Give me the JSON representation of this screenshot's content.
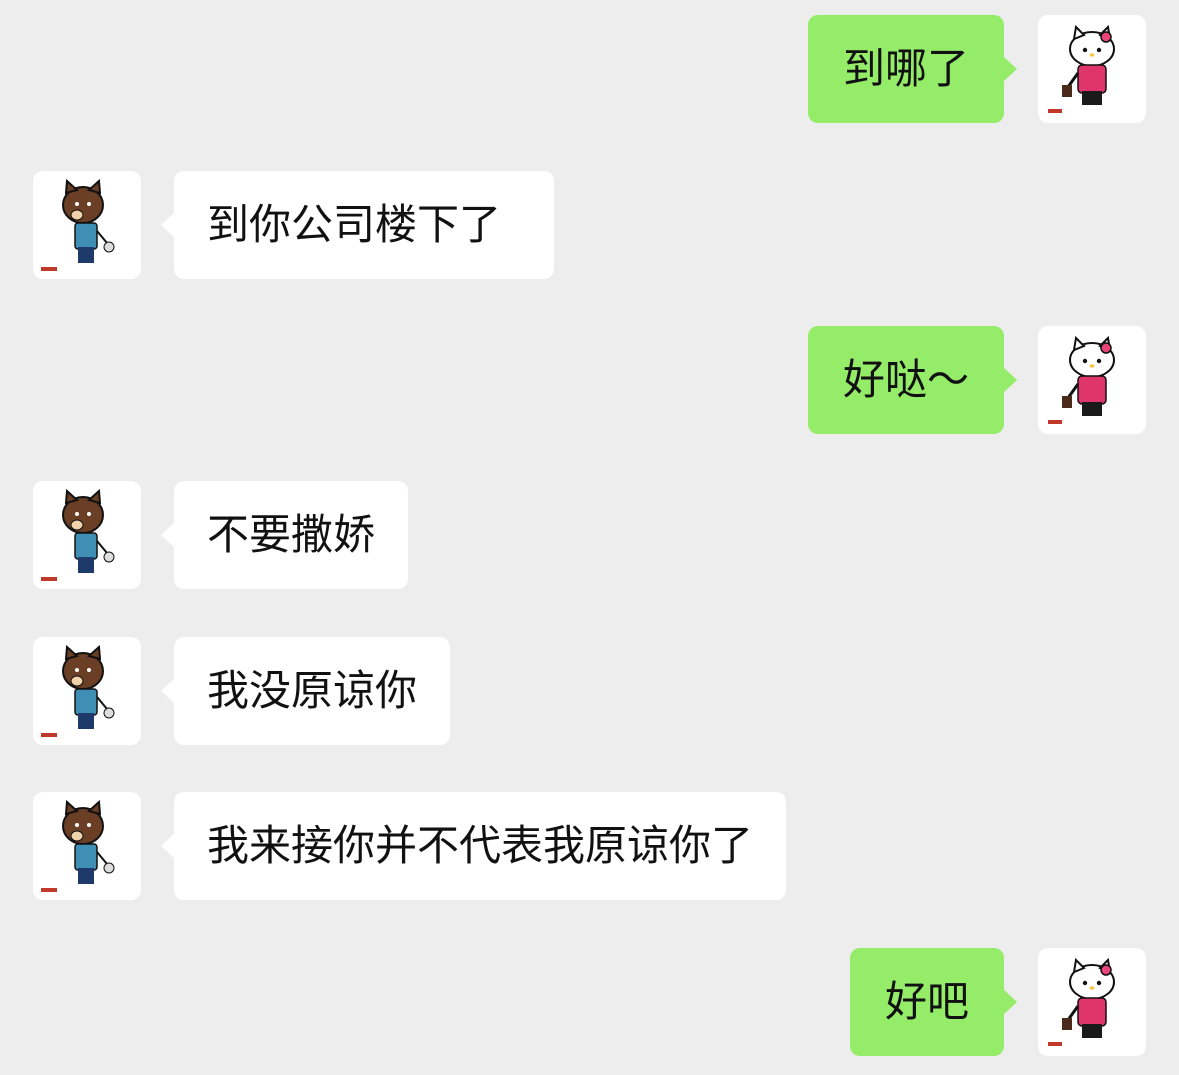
{
  "chat": {
    "messages": [
      {
        "sender": "me",
        "text": "到哪了"
      },
      {
        "sender": "other",
        "text": "到你公司楼下了"
      },
      {
        "sender": "me",
        "text": "好哒～"
      },
      {
        "sender": "other",
        "text": "不要撒娇"
      },
      {
        "sender": "other",
        "text": "我没原谅你"
      },
      {
        "sender": "other",
        "text": "我来接你并不代表我原谅你了"
      },
      {
        "sender": "me",
        "text": "好吧"
      }
    ]
  },
  "colors": {
    "background": "#ededed",
    "outgoing_bubble": "#95ec69",
    "incoming_bubble": "#ffffff",
    "text": "#111111"
  },
  "icons": {
    "me_avatar": "hello-kitty-avatar-icon",
    "other_avatar": "brown-cat-avatar-icon"
  }
}
